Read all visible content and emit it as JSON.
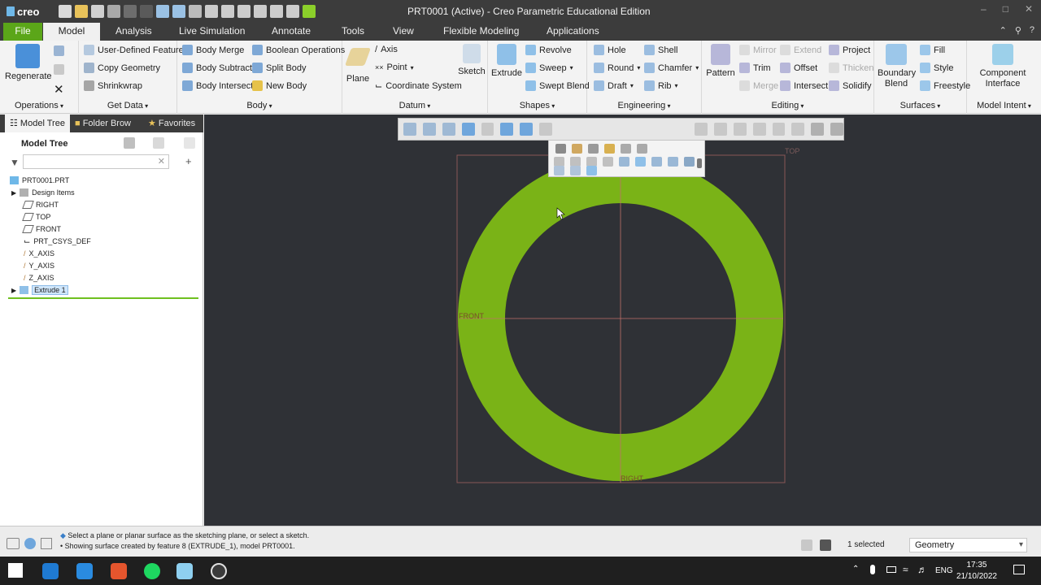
{
  "titlebar": {
    "app_logo": "creo",
    "title": "PRT0001 (Active) - Creo Parametric Educational Edition",
    "window_controls": [
      "minimize-icon",
      "maximize-icon",
      "close-icon"
    ]
  },
  "menu": {
    "tabs": [
      "File",
      "Model",
      "Analysis",
      "Live Simulation",
      "Annotate",
      "Tools",
      "View",
      "Flexible Modeling",
      "Applications"
    ],
    "active_tab": "Model"
  },
  "ribbon": {
    "operations": {
      "label": "Operations",
      "regenerate": "Regenerate"
    },
    "get_data": {
      "label": "Get Data",
      "items": [
        "User-Defined Feature",
        "Copy Geometry",
        "Shrinkwrap"
      ]
    },
    "body": {
      "label": "Body",
      "items": [
        "Body Merge",
        "Boolean Operations",
        "Body Subtract",
        "Split Body",
        "Body Intersect",
        "New Body"
      ]
    },
    "datum": {
      "label": "Datum",
      "plane": "Plane",
      "axis": "Axis",
      "point": "Point",
      "coordinate_system": "Coordinate System",
      "sketch": "Sketch"
    },
    "shapes": {
      "label": "Shapes",
      "extrude": "Extrude",
      "revolve": "Revolve",
      "sweep": "Sweep",
      "swept_blend": "Swept Blend"
    },
    "engineering": {
      "label": "Engineering",
      "items": [
        "Hole",
        "Shell",
        "Round",
        "Chamfer",
        "Draft",
        "Rib"
      ]
    },
    "editing": {
      "label": "Editing",
      "pattern": "Pattern",
      "items": [
        "Mirror",
        "Extend",
        "Project",
        "Trim",
        "Offset",
        "Thicken",
        "Merge",
        "Intersect",
        "Solidify"
      ]
    },
    "surfaces": {
      "label": "Surfaces",
      "boundary_blend": "Boundary Blend",
      "items": [
        "Fill",
        "Style",
        "Freestyle"
      ]
    },
    "model_intent": {
      "label": "Model Intent",
      "component_interface": "Component Interface"
    }
  },
  "left_panel": {
    "tabs": [
      "Model Tree",
      "Folder Brow",
      "Favorites"
    ],
    "header": "Model Tree",
    "search_placeholder": "",
    "tree": [
      "PRT0001.PRT",
      "Design Items",
      "RIGHT",
      "TOP",
      "FRONT",
      "PRT_CSYS_DEF",
      "X_AXIS",
      "Y_AXIS",
      "Z_AXIS",
      "Extrude 1"
    ],
    "selected": "Extrude 1"
  },
  "graphics": {
    "datum_labels": {
      "top": "TOP",
      "front": "FRONT",
      "right": "RIGHT"
    },
    "colors": {
      "background": "#2f3136",
      "ring": "#7ab317",
      "datum": "#c0706a"
    }
  },
  "status": {
    "message_1": "Select a plane or planar surface as the sketching plane, or select a sketch.",
    "message_2": "Showing surface created by feature 8 (EXTRUDE_1), model PRT0001.",
    "selected_count": "1 selected",
    "filter": "Geometry"
  },
  "taskbar": {
    "lang": "ENG",
    "time": "17:35",
    "date": "21/10/2022"
  }
}
